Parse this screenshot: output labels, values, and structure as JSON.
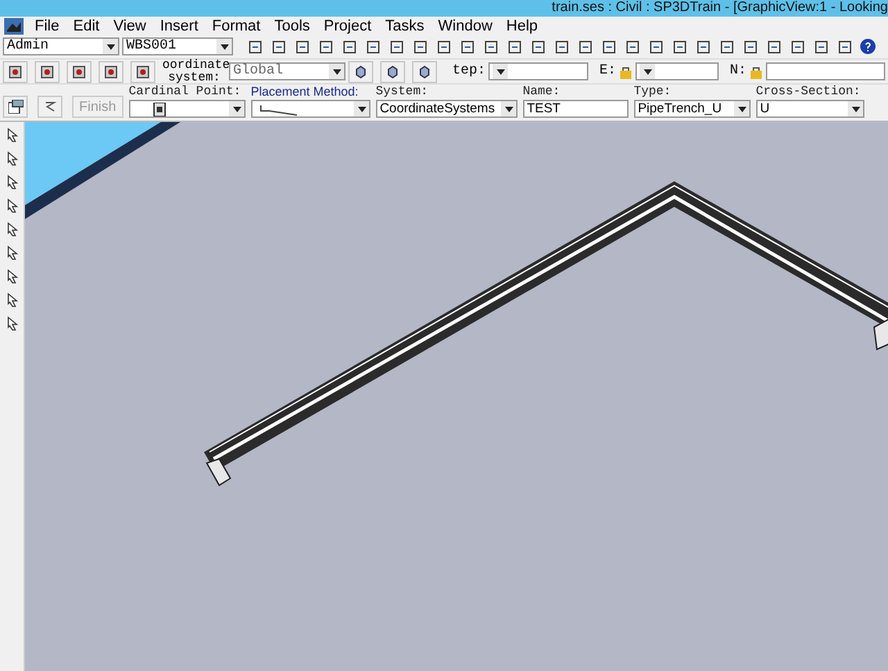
{
  "window": {
    "title": "train.ses : Civil : SP3DTrain - [GraphicView:1 - Looking"
  },
  "menu": [
    "File",
    "Edit",
    "View",
    "Insert",
    "Format",
    "Tools",
    "Project",
    "Tasks",
    "Window",
    "Help"
  ],
  "toolbar_1": {
    "permission_group": "Admin",
    "workspace": "WBS001"
  },
  "toolbar_2": {
    "coordinate_label": "oordinate system:",
    "coordinate_system": "Global",
    "step_label": "tep:",
    "e_label": "E:",
    "n_label": "N:"
  },
  "ribbon": {
    "finish": {
      "label": "Finish",
      "disabled": true
    },
    "fields": [
      {
        "label": "Cardinal Point:",
        "kind": "icon"
      },
      {
        "label": "Placement Method:",
        "kind": "line"
      },
      {
        "label": "System:",
        "value": "CoordinateSystems",
        "kind": "text"
      },
      {
        "label": "Name:",
        "value": "TEST",
        "kind": "input"
      },
      {
        "label": "Type:",
        "value": "PipeTrench_U",
        "kind": "text"
      },
      {
        "label": "Cross-Section:",
        "value": "U",
        "kind": "text"
      }
    ]
  }
}
